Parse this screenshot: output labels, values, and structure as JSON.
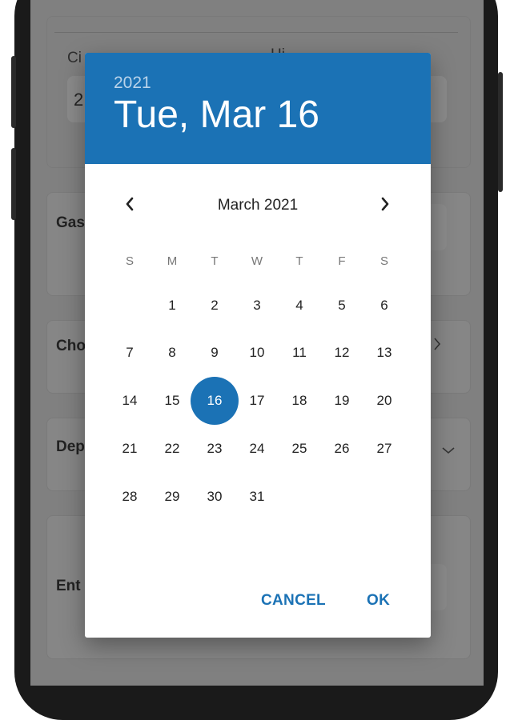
{
  "background": {
    "city_label": "Ci",
    "city_value": "2",
    "other_label": "Hi",
    "gas_label": "Gas",
    "choose_label": "Cho",
    "dep_label": "Dep",
    "enter_label": "Ent"
  },
  "dialog": {
    "header": {
      "year": "2021",
      "date": "Tue, Mar 16"
    },
    "month_label": "March 2021",
    "weekdays": [
      "S",
      "M",
      "T",
      "W",
      "T",
      "F",
      "S"
    ],
    "weeks": [
      [
        "",
        "1",
        "2",
        "3",
        "4",
        "5",
        "6"
      ],
      [
        "7",
        "8",
        "9",
        "10",
        "11",
        "12",
        "13"
      ],
      [
        "14",
        "15",
        "16",
        "17",
        "18",
        "19",
        "20"
      ],
      [
        "21",
        "22",
        "23",
        "24",
        "25",
        "26",
        "27"
      ],
      [
        "28",
        "29",
        "30",
        "31",
        "",
        "",
        ""
      ]
    ],
    "selected_day": "16",
    "actions": {
      "cancel": "CANCEL",
      "ok": "OK"
    }
  },
  "colors": {
    "accent": "#1b72b5",
    "header_year": "#b9d3ea",
    "scrim": "#808080"
  }
}
